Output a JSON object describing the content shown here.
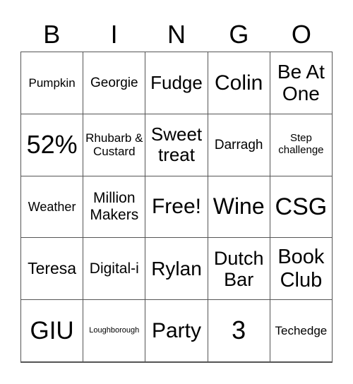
{
  "title_letters": [
    "B",
    "I",
    "N",
    "G",
    "O"
  ],
  "cells": [
    {
      "text": "Pumpkin",
      "size": 17
    },
    {
      "text": "Georgie",
      "size": 19
    },
    {
      "text": "Fudge",
      "size": 26
    },
    {
      "text": "Colin",
      "size": 30
    },
    {
      "text": "Be At One",
      "size": 28
    },
    {
      "text": "52%",
      "size": 36
    },
    {
      "text": "Rhubarb & Custard",
      "size": 17
    },
    {
      "text": "Sweet treat",
      "size": 26
    },
    {
      "text": "Darragh",
      "size": 19
    },
    {
      "text": "Step challenge",
      "size": 15
    },
    {
      "text": "Weather",
      "size": 18
    },
    {
      "text": "Million Makers",
      "size": 21
    },
    {
      "text": "Free!",
      "size": 30
    },
    {
      "text": "Wine",
      "size": 32
    },
    {
      "text": "CSG",
      "size": 34
    },
    {
      "text": "Teresa",
      "size": 23
    },
    {
      "text": "Digital-i",
      "size": 21
    },
    {
      "text": "Rylan",
      "size": 28
    },
    {
      "text": "Dutch Bar",
      "size": 27
    },
    {
      "text": "Book Club",
      "size": 29
    },
    {
      "text": "GIU",
      "size": 35
    },
    {
      "text": "Loughborough",
      "size": 11
    },
    {
      "text": "Party",
      "size": 30
    },
    {
      "text": "3",
      "size": 36
    },
    {
      "text": "Techedge",
      "size": 17
    }
  ]
}
